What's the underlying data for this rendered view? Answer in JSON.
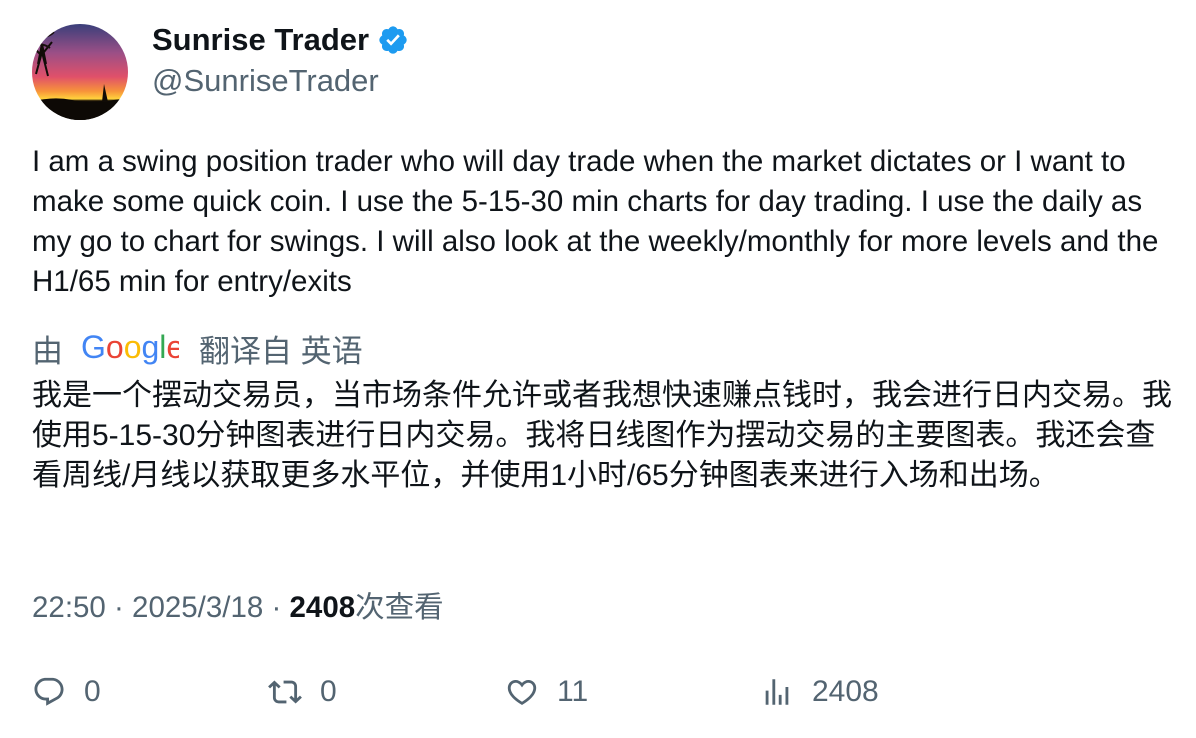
{
  "author": {
    "display_name": "Sunrise Trader",
    "handle": "@SunriseTrader",
    "verified": true,
    "verified_color": "#1d9bf0"
  },
  "tweet": {
    "text": "I am a swing position trader who will day trade when the market dictates or I want to make some quick coin. I use the 5-15-30 min charts for day trading. I use the daily as my go to chart for swings. I will also look at the weekly/monthly for more levels and the H1/65 min for entry/exits"
  },
  "translation": {
    "prefix": "由",
    "provider": "Google",
    "suffix": "翻译自 英语",
    "text": "我是一个摆动交易员，当市场条件允许或者我想快速赚点钱时，我会进行日内交易。我使用5-15-30分钟图表进行日内交易。我将日线图作为摆动交易的主要图表。我还会查看周线/月线以获取更多水平位，并使用1小时/65分钟图表来进行入场和出场。"
  },
  "meta": {
    "time": "22:50",
    "separator1": " · ",
    "date": "2025/3/18",
    "separator2": " · ",
    "views_count": "2408",
    "views_label": "次查看"
  },
  "actions": {
    "replies": "0",
    "retweets": "0",
    "likes": "11",
    "views": "2408"
  },
  "icons": {
    "reply": "reply-icon",
    "retweet": "retweet-icon",
    "like": "heart-icon",
    "views": "analytics-icon",
    "verified": "verified-badge-icon"
  }
}
